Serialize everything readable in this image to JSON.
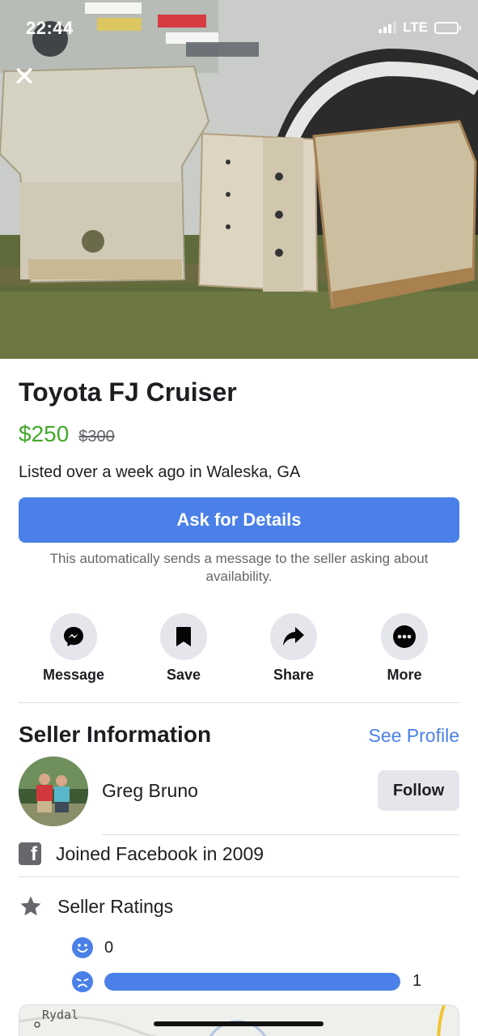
{
  "status_bar": {
    "time": "22:44",
    "network": "LTE"
  },
  "hero": {
    "image": "Metal skid plates leaning against a sticker-covered trailer",
    "close_icon": "close-icon"
  },
  "listing": {
    "title": "Toyota FJ Cruiser",
    "price": "$250",
    "original_price": "$300",
    "listed": "Listed over a week ago in Waleska, GA"
  },
  "ask": {
    "button_label": "Ask for Details",
    "note": "This automatically sends a message to the seller asking about availability."
  },
  "actions": [
    {
      "label": "Message",
      "icon": "messenger-icon"
    },
    {
      "label": "Save",
      "icon": "bookmark-icon"
    },
    {
      "label": "Share",
      "icon": "share-arrow-icon"
    },
    {
      "label": "More",
      "icon": "more-dots-icon"
    }
  ],
  "seller": {
    "section_title": "Seller Information",
    "see_profile": "See Profile",
    "name": "Greg Bruno",
    "follow_label": "Follow",
    "joined": "Joined Facebook in 2009",
    "ratings_title": "Seller Ratings",
    "ratings": {
      "positive": "0",
      "negative": "1",
      "negative_fraction": 1.0
    }
  },
  "map": {
    "label": "Rydal"
  },
  "colors": {
    "accent": "#4a80e8",
    "price": "#42a82a",
    "muted": "#65676b"
  }
}
